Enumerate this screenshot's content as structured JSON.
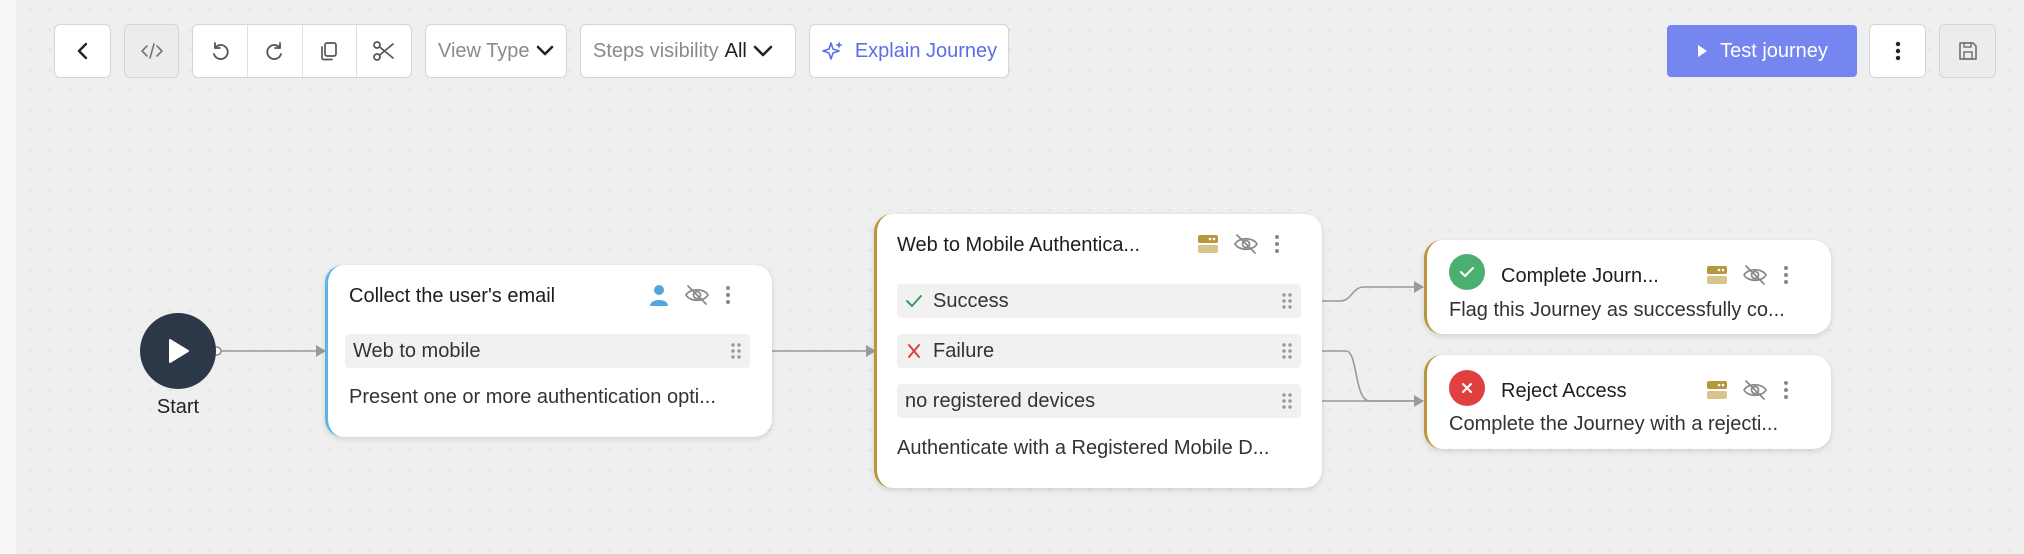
{
  "toolbar": {
    "view_type_label": "View Type",
    "steps_visibility_label": "Steps visibility",
    "steps_visibility_value": "All",
    "explain_label": "Explain Journey",
    "test_label": "Test journey"
  },
  "start": {
    "label": "Start"
  },
  "nodes": {
    "collect_email": {
      "title": "Collect the user's email",
      "outcomes": [
        "Web to mobile"
      ],
      "description": "Present one or more authentication opti..."
    },
    "web_to_mobile": {
      "title": "Web to Mobile Authentica...",
      "outcomes": [
        "Success",
        "Failure",
        "no registered devices"
      ],
      "description": "Authenticate with a Registered Mobile D..."
    },
    "complete": {
      "title": "Complete Journ...",
      "description": "Flag this Journey as successfully co..."
    },
    "reject": {
      "title": "Reject Access",
      "description": "Complete the Journey with a rejecti..."
    }
  },
  "colors": {
    "accent": "#7586f1",
    "success": "#4caf72",
    "failure": "#e14040",
    "node_border_blue": "#5ab4e8",
    "node_border_gold": "#b8973a",
    "start_fill": "#2c3848"
  }
}
